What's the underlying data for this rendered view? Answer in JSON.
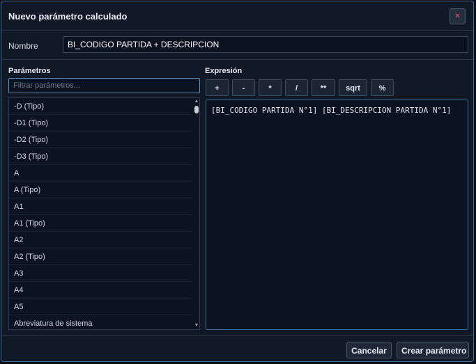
{
  "dialog": {
    "title": "Nuevo parámetro calculado",
    "close_label": "×"
  },
  "name": {
    "label": "Nombre",
    "value": "BI_CODIGO PARTIDA + DESCRIPCION"
  },
  "params": {
    "label": "Parámetros",
    "filter_placeholder": "Filtrar parámetros...",
    "items": [
      "-D (Tipo)",
      "-D1 (Tipo)",
      "-D2 (Tipo)",
      "-D3 (Tipo)",
      "A",
      "A (Tipo)",
      "A1",
      "A1 (Tipo)",
      "A2",
      "A2 (Tipo)",
      "A3",
      "A4",
      "A5",
      "Abreviatura de sistema"
    ]
  },
  "expression": {
    "label": "Expresión",
    "operators": [
      "+",
      "-",
      "*",
      "/",
      "**",
      "sqrt",
      "%"
    ],
    "text": "[BI_CODIGO PARTIDA N°1] [BI_DESCRIPCION PARTIDA N°1]"
  },
  "footer": {
    "cancel_label": "Cancelar",
    "create_label": "Crear parámetro"
  }
}
